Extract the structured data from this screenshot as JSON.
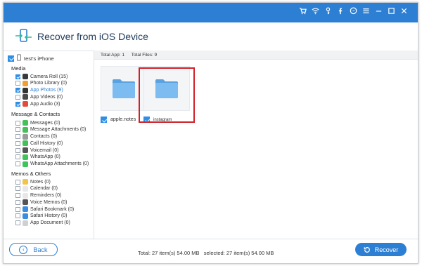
{
  "app": {
    "title": "Recover from iOS Device"
  },
  "sidebar": {
    "device": "test's iPhone",
    "sections": {
      "media": "Media",
      "messages": "Message & Contacts",
      "memos": "Memos & Others"
    },
    "media_items": [
      {
        "label": "Camera Roll (15)",
        "checked": true,
        "icon_color": "#3a3a3a"
      },
      {
        "label": "Photo Library (0)",
        "checked": false,
        "icon_color": "#f0a030"
      },
      {
        "label": "App Photos (9)",
        "checked": true,
        "icon_color": "#333333",
        "color": "#2d7fd3"
      },
      {
        "label": "App Videos (0)",
        "checked": false,
        "icon_color": "#4a4a4a"
      },
      {
        "label": "App Audio (3)",
        "checked": true,
        "icon_color": "#e34b3b"
      }
    ],
    "message_items": [
      {
        "label": "Messages (0)",
        "icon_color": "#44c05a"
      },
      {
        "label": "Message Attachments (0)",
        "icon_color": "#44c05a"
      },
      {
        "label": "Contacts (0)",
        "icon_color": "#9b9b9b"
      },
      {
        "label": "Call History (0)",
        "icon_color": "#44c05a"
      },
      {
        "label": "Voicemail (0)",
        "icon_color": "#555555"
      },
      {
        "label": "WhatsApp (0)",
        "icon_color": "#3ec45a"
      },
      {
        "label": "WhatsApp Attachments (0)",
        "icon_color": "#3ec45a"
      }
    ],
    "memo_items": [
      {
        "label": "Notes (0)",
        "icon_color": "#f3c44a"
      },
      {
        "label": "Calendar (0)",
        "icon_color": "#e8e8e8"
      },
      {
        "label": "Reminders (0)",
        "icon_color": "#e8e8e8"
      },
      {
        "label": "Voice Memos (0)",
        "icon_color": "#555555"
      },
      {
        "label": "Safari Bookmark (0)",
        "icon_color": "#3b8de0"
      },
      {
        "label": "Safari History (0)",
        "icon_color": "#3b8de0"
      },
      {
        "label": "App Document (0)",
        "icon_color": "#d0d0d0"
      }
    ]
  },
  "main": {
    "total_app": "Total App: 1",
    "total_files": "Total Files: 9",
    "tiles": [
      {
        "label": "apple.notes",
        "checked": true
      },
      {
        "label": "instagram",
        "checked": true
      }
    ]
  },
  "footer": {
    "back": "Back",
    "summary": "Total: 27 item(s) 54.00 MB   selected: 27 item(s) 54.00 MB",
    "recover": "Recover"
  },
  "colors": {
    "accent": "#2d7fd3",
    "highlight": "#d0202a",
    "folder": "#6aaee6"
  },
  "titlebar_icons": [
    "cart-icon",
    "wifi-icon",
    "key-icon",
    "facebook-icon",
    "chat-icon",
    "menu-icon",
    "minimize-icon",
    "maximize-icon",
    "close-icon"
  ]
}
